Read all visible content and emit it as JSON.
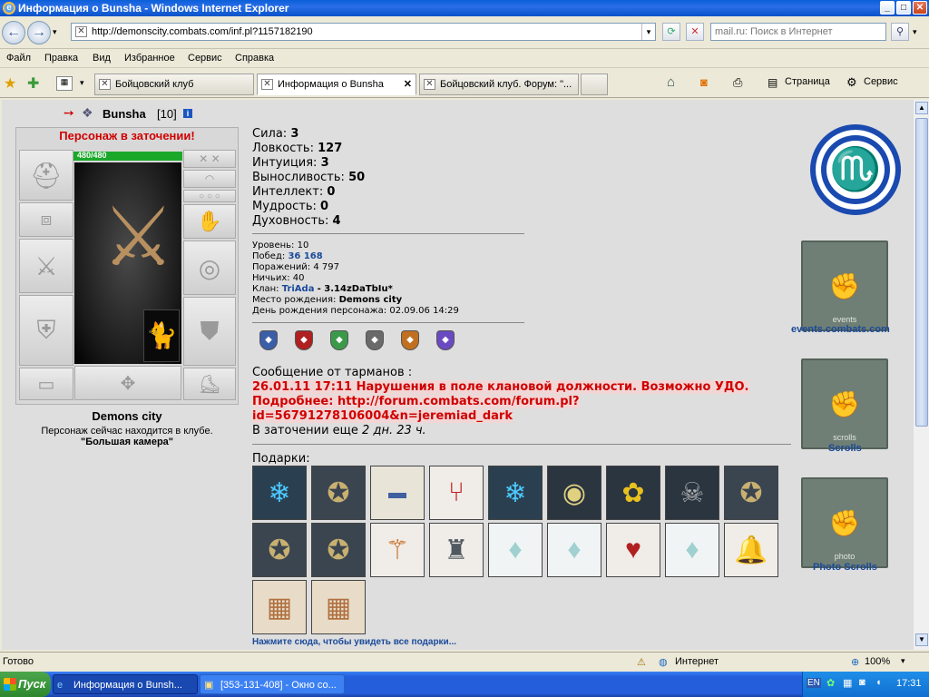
{
  "window": {
    "title": "Информация о Bunsha - Windows Internet Explorer"
  },
  "address": {
    "url": "http://demonscity.combats.com/inf.pl?1157182190",
    "search_placeholder": "mail.ru: Поиск в Интернет"
  },
  "menu": [
    "Файл",
    "Правка",
    "Вид",
    "Избранное",
    "Сервис",
    "Справка"
  ],
  "tabs": [
    {
      "label": "Бойцовский клуб"
    },
    {
      "label": "Информация о Bunsha"
    },
    {
      "label": "Бойцовский клуб. Форум: \"..."
    }
  ],
  "toolbar": {
    "page": "Страница",
    "tools": "Сервис"
  },
  "character": {
    "name": "Bunsha",
    "level_tag": "[10]",
    "status_title": "Персонаж в заточении!",
    "hp": "480/480",
    "hp_fraction": 1.0,
    "city": "Demons city",
    "location_line": "Персонаж сейчас находится в клубе.",
    "location": "\"Большая камера\""
  },
  "stats": [
    {
      "label": "Сила:",
      "value": "3"
    },
    {
      "label": "Ловкость:",
      "value": "127"
    },
    {
      "label": "Интуиция:",
      "value": "3"
    },
    {
      "label": "Выносливость:",
      "value": "50"
    },
    {
      "label": "Интеллект:",
      "value": "0"
    },
    {
      "label": "Мудрость:",
      "value": "0"
    },
    {
      "label": "Духовность:",
      "value": "4"
    }
  ],
  "info": {
    "level": "Уровень: 10",
    "wins_label": "Побед:",
    "wins": "36 168",
    "losses": "Поражений: 4 797",
    "draws": "Ничьих: 40",
    "clan_label": "Клан:",
    "clan": "TriAda",
    "clan_extra": "- 3.14zDaTbIu*",
    "birthplace_label": "Место рождения:",
    "birthplace": "Demons city",
    "birthday": "День рождения персонажа: 02.09.06 14:29"
  },
  "message": {
    "header": "Сообщение от тарманов :",
    "line1": "26.01.11 17:11 Нарушения в поле клановой должности. Возможно УДО.",
    "line2": "Подробнее: http://forum.combats.com/forum.pl?",
    "line3": "id=56791278106004&n=jeremiad_dark",
    "remaining_label": "В заточении еще",
    "remaining": "2 дн. 23 ч."
  },
  "gifts": {
    "label": "Подарки:",
    "more_link": "Нажмите сюда, чтобы увидеть все подарки..."
  },
  "side_links": {
    "events": "events.combats.com",
    "events_banner": "events",
    "scrolls": "Scrolls",
    "scrolls_banner": "scrolls",
    "photo": "Photo Scrolls",
    "photo_banner": "photo"
  },
  "status": {
    "left": "Готово",
    "zone": "Интернет",
    "zoom": "100%"
  },
  "taskbar": {
    "start": "Пуск",
    "items": [
      "Информация о Bunsh...",
      "[353-131-408] - Окно со..."
    ],
    "lang": "EN",
    "clock": "17:31"
  }
}
